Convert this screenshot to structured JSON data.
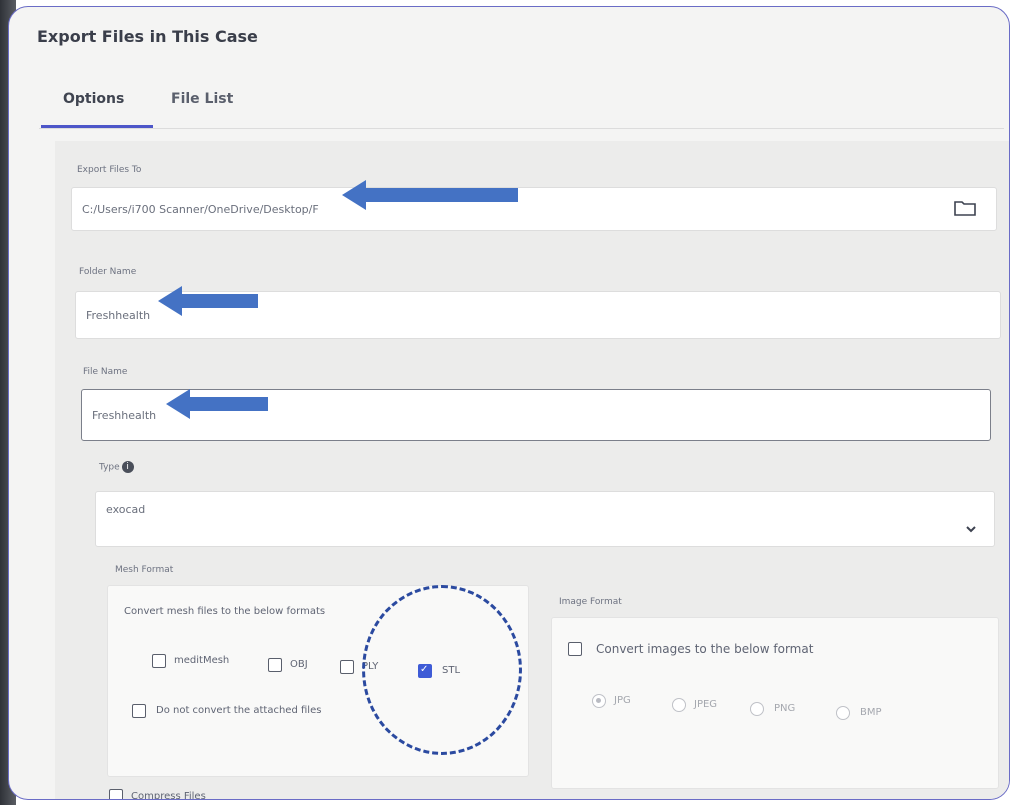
{
  "window": {
    "title": "Export Files in This Case"
  },
  "tabs": [
    {
      "label": "Options"
    },
    {
      "label": "File List"
    }
  ],
  "export_to": {
    "label": "Export Files To",
    "value": "C:/Users/i700 Scanner/OneDrive/Desktop/F"
  },
  "folder_name": {
    "label": "Folder Name",
    "value": "Freshhealth"
  },
  "file_name": {
    "label": "File Name",
    "value": "Freshhealth"
  },
  "type": {
    "label": "Type",
    "info": "i",
    "value": "exocad"
  },
  "mesh_format": {
    "label": "Mesh Format",
    "description": "Convert mesh files to the below formats",
    "options": [
      {
        "label": "meditMesh",
        "checked": false
      },
      {
        "label": "OBJ",
        "checked": false
      },
      {
        "label": "PLY",
        "checked": false
      },
      {
        "label": "STL",
        "checked": true
      }
    ],
    "no_convert_label": "Do not convert the attached files"
  },
  "image_format": {
    "label": "Image Format",
    "convert_label": "Convert images to the below format",
    "options": [
      "JPG",
      "JPEG",
      "PNG",
      "BMP"
    ],
    "selected": "JPG"
  },
  "compress": {
    "label": "Compress Files"
  },
  "annotations": {
    "arrow_color": "#4472c4",
    "circle_color": "#2b4aa0"
  }
}
